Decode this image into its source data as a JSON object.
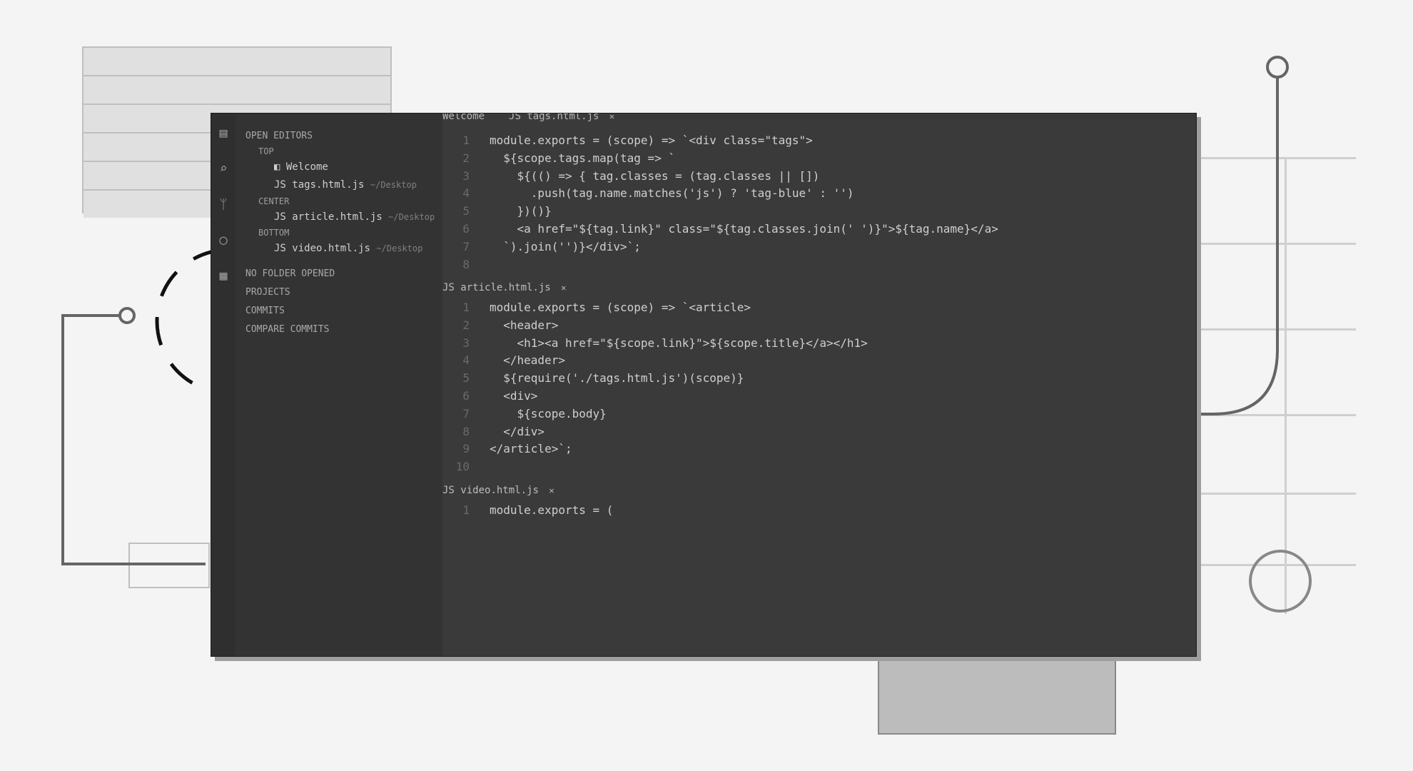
{
  "tabs": {
    "welcome": "Welcome",
    "file_lang_prefix": "JS",
    "active_file": "tags.html.js"
  },
  "sidebar": {
    "open_editors": "OPEN EDITORS",
    "groups": {
      "top": "TOP",
      "center": "CENTER",
      "bottom": "BOTTOM"
    },
    "files": {
      "welcome": "Welcome",
      "tags": "tags.html.js",
      "tags_path": "~/Desktop",
      "article": "article.html.js",
      "article_path": "~/Desktop",
      "video": "video.html.js",
      "video_path": "~/Desktop"
    },
    "sections": {
      "no_folder": "NO FOLDER OPENED",
      "projects": "PROJECTS",
      "commits": "COMMITS",
      "compare": "COMPARE COMMITS"
    }
  },
  "panes": {
    "tags": {
      "name": "tags.html.js",
      "lines": [
        "module.exports = (scope) => `<div class=\"tags\">",
        "  ${scope.tags.map(tag => `",
        "    ${(() => { tag.classes = (tag.classes || [])",
        "      .push(tag.name.matches('js') ? 'tag-blue' : '')",
        "    })()}",
        "    <a href=\"${tag.link}\" class=\"${tag.classes.join(' ')}\">${tag.name}</a>",
        "  `).join('')}</div>`;",
        ""
      ]
    },
    "article": {
      "name": "article.html.js",
      "lines": [
        "module.exports = (scope) => `<article>",
        "  <header>",
        "    <h1><a href=\"${scope.link}\">${scope.title}</a></h1>",
        "  </header>",
        "  ${require('./tags.html.js')(scope)}",
        "  <div>",
        "    ${scope.body}",
        "  </div>",
        "</article>`;",
        ""
      ]
    },
    "video": {
      "name": "video.html.js",
      "lines": [
        "module.exports = ("
      ]
    }
  }
}
